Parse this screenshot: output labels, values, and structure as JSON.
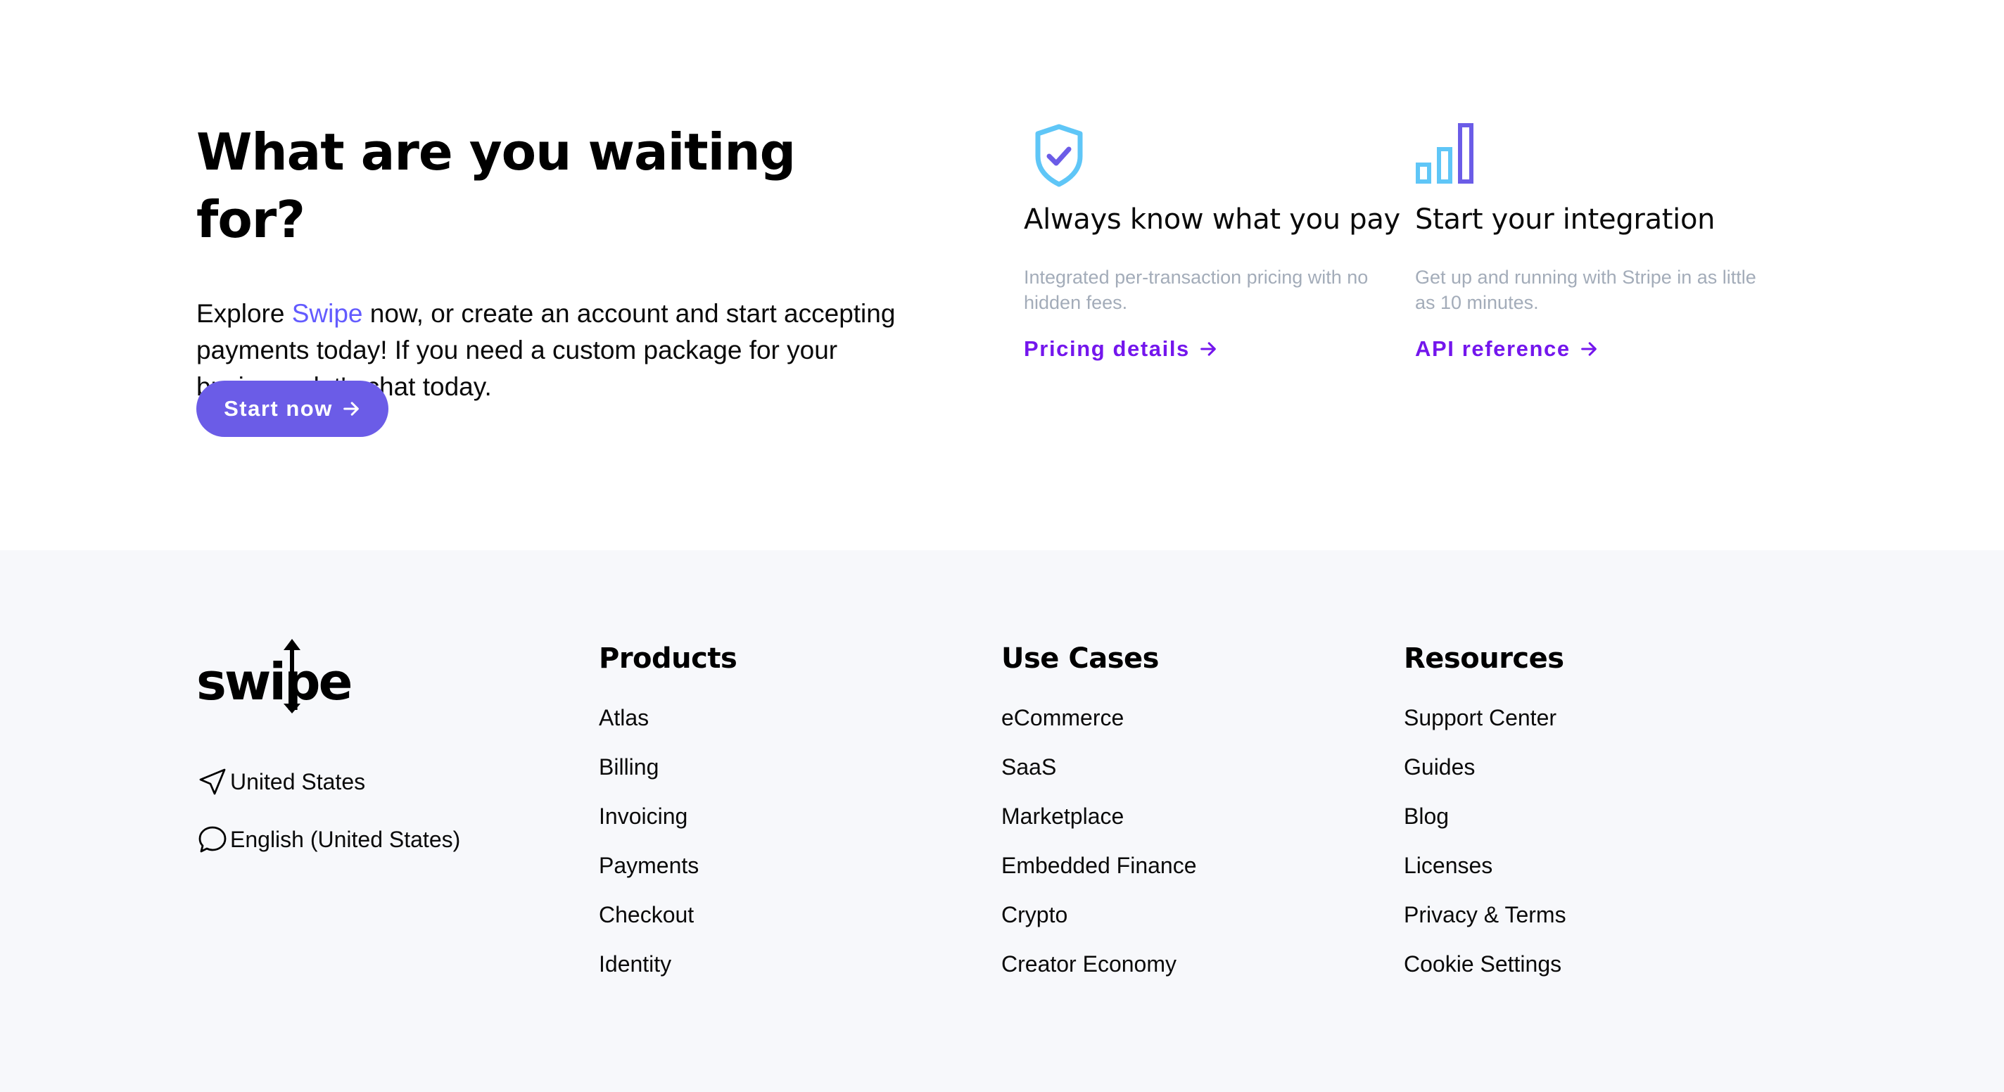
{
  "cta": {
    "title": "What are you waiting for?",
    "body_prefix": "Explore ",
    "body_brand": "Swipe",
    "body_suffix": " now, or create an account and start accepting payments today! If you need a custom package for your business, let's chat today.",
    "button_label": "Start now",
    "button_icon": "arrow-right-icon"
  },
  "features": [
    {
      "icon": "shield-check-icon",
      "title": "Always know what you pay",
      "description": "Integrated per-transaction pricing with no hidden fees.",
      "link_label": "Pricing details",
      "link_icon": "arrow-right-icon"
    },
    {
      "icon": "bar-chart-icon",
      "title": "Start your integration",
      "description": "Get up and running with Stripe in as little as 10 minutes.",
      "link_label": "API reference",
      "link_icon": "arrow-right-icon"
    }
  ],
  "footer": {
    "logo_text": "swipe",
    "locale": {
      "country": "United States",
      "country_icon": "location-arrow-icon",
      "language": "English (United States)",
      "language_icon": "chat-bubble-icon"
    },
    "columns": [
      {
        "heading": "Products",
        "links": [
          "Atlas",
          "Billing",
          "Invoicing",
          "Payments",
          "Checkout",
          "Identity"
        ]
      },
      {
        "heading": "Use Cases",
        "links": [
          "eCommerce",
          "SaaS",
          "Marketplace",
          "Embedded Finance",
          "Crypto",
          "Creator Economy"
        ]
      },
      {
        "heading": "Resources",
        "links": [
          "Support Center",
          "Guides",
          "Blog",
          "Licenses",
          "Privacy & Terms",
          "Cookie Settings"
        ]
      }
    ]
  },
  "colors": {
    "brand": "#635bff",
    "button_bg": "#6b5ce7",
    "link": "#7416ed",
    "muted_text": "#a3acb9",
    "footer_bg": "#f7f8fb",
    "icon_light_blue": "#5fc6f7",
    "icon_purple": "#6b5ce7"
  }
}
